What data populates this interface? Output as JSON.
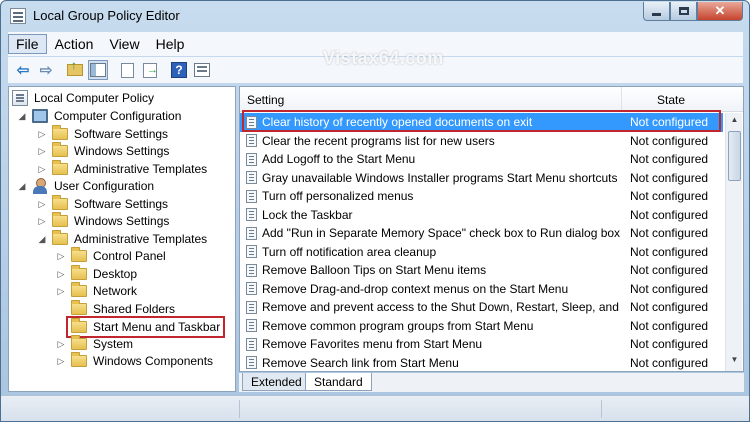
{
  "window": {
    "title": "Local Group Policy Editor",
    "close_glyph": "✕"
  },
  "watermark": "Vistax64.com",
  "menu": [
    "File",
    "Action",
    "View",
    "Help"
  ],
  "toolbar": {
    "icons": [
      "back-icon",
      "forward-icon",
      "up-folder-icon",
      "show-hide-tree-icon",
      "properties-doc-icon",
      "export-list-icon",
      "help-icon",
      "properties-icon"
    ],
    "help_glyph": "?"
  },
  "tree": {
    "nodes": [
      {
        "label": "Local Computer Policy",
        "level": 0,
        "icon": "policy",
        "twisty": ""
      },
      {
        "label": "Computer Configuration",
        "level": 1,
        "icon": "computer",
        "twisty": "expanded"
      },
      {
        "label": "Software Settings",
        "level": 2,
        "icon": "folder",
        "twisty": "collapsed"
      },
      {
        "label": "Windows Settings",
        "level": 2,
        "icon": "folder",
        "twisty": "collapsed"
      },
      {
        "label": "Administrative Templates",
        "level": 2,
        "icon": "folder",
        "twisty": "collapsed"
      },
      {
        "label": "User Configuration",
        "level": 1,
        "icon": "user",
        "twisty": "expanded"
      },
      {
        "label": "Software Settings",
        "level": 2,
        "icon": "folder",
        "twisty": "collapsed"
      },
      {
        "label": "Windows Settings",
        "level": 2,
        "icon": "folder",
        "twisty": "collapsed"
      },
      {
        "label": "Administrative Templates",
        "level": 2,
        "icon": "folder",
        "twisty": "expanded"
      },
      {
        "label": "Control Panel",
        "level": 3,
        "icon": "folder",
        "twisty": "collapsed"
      },
      {
        "label": "Desktop",
        "level": 3,
        "icon": "folder",
        "twisty": "collapsed"
      },
      {
        "label": "Network",
        "level": 3,
        "icon": "folder",
        "twisty": "collapsed"
      },
      {
        "label": "Shared Folders",
        "level": 3,
        "icon": "folder",
        "twisty": ""
      },
      {
        "label": "Start Menu and Taskbar",
        "level": 3,
        "icon": "folder",
        "twisty": "",
        "selected": true
      },
      {
        "label": "System",
        "level": 3,
        "icon": "folder",
        "twisty": "collapsed"
      },
      {
        "label": "Windows Components",
        "level": 3,
        "icon": "folder",
        "twisty": "collapsed"
      }
    ]
  },
  "list": {
    "columns": {
      "setting": "Setting",
      "state": "State"
    },
    "rows": [
      {
        "setting": "Clear history of recently opened documents on exit",
        "state": "Not configured",
        "selected": true
      },
      {
        "setting": "Clear the recent programs list for new users",
        "state": "Not configured"
      },
      {
        "setting": "Add Logoff to the Start Menu",
        "state": "Not configured"
      },
      {
        "setting": "Gray unavailable Windows Installer programs Start Menu shortcuts",
        "state": "Not configured"
      },
      {
        "setting": "Turn off personalized menus",
        "state": "Not configured"
      },
      {
        "setting": "Lock the Taskbar",
        "state": "Not configured"
      },
      {
        "setting": "Add \"Run in Separate Memory Space\" check box to Run dialog box",
        "state": "Not configured"
      },
      {
        "setting": "Turn off notification area cleanup",
        "state": "Not configured"
      },
      {
        "setting": "Remove Balloon Tips on Start Menu items",
        "state": "Not configured"
      },
      {
        "setting": "Remove Drag-and-drop context menus on the Start Menu",
        "state": "Not configured"
      },
      {
        "setting": "Remove and prevent access to the Shut Down, Restart, Sleep, and H...",
        "state": "Not configured"
      },
      {
        "setting": "Remove common program groups from Start Menu",
        "state": "Not configured"
      },
      {
        "setting": "Remove Favorites menu from Start Menu",
        "state": "Not configured"
      },
      {
        "setting": "Remove Search link from Start Menu",
        "state": "Not configured"
      }
    ],
    "scroll_up_glyph": "▲",
    "scroll_down_glyph": "▼"
  },
  "tabs": [
    "Extended",
    "Standard"
  ],
  "colors": {
    "selection": "#3399ff",
    "highlight_outline": "#c0262d"
  }
}
